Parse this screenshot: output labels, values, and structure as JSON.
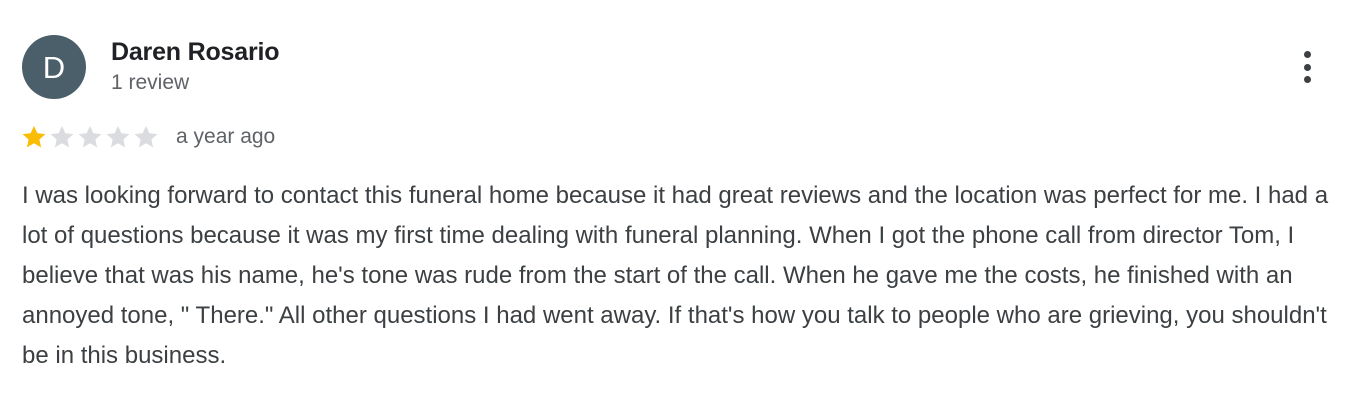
{
  "review": {
    "author": {
      "initial": "D",
      "name": "Daren Rosario",
      "review_count": "1 review",
      "avatar_color": "#4b5f6b"
    },
    "rating": {
      "value": 1,
      "max": 5,
      "filled_color": "#fbbc04",
      "empty_color": "#dadce0"
    },
    "timestamp": "a year ago",
    "text": "I was looking forward to contact this funeral home because it had great reviews and the location was perfect for me. I had a lot of questions because it was my first time dealing with funeral planning. When I got the phone call from director Tom, I believe that was his name, he's tone was rude from the start of the call. When he gave me the costs, he finished with an annoyed tone, \" There.\" All other questions I had went away. If that's how you talk to people who are grieving, you shouldn't be in this business.",
    "menu_icon": "more-vert-icon"
  }
}
